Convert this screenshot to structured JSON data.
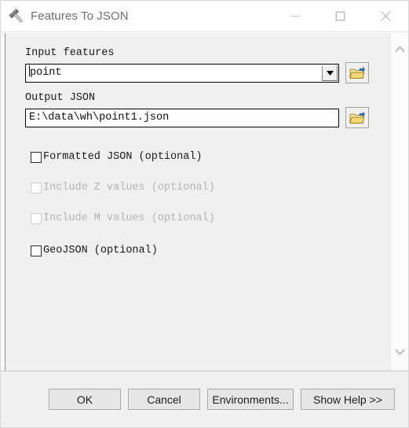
{
  "window": {
    "title": "Features To JSON",
    "icon": "hammer-tool-icon",
    "controls": {
      "minimize": "minimize-icon",
      "maximize": "maximize-icon",
      "close": "close-icon"
    }
  },
  "form": {
    "input_features": {
      "label": "Input features",
      "value": "point",
      "dropdown_icon": "chevron-down-icon",
      "browse_icon": "folder-browse-icon"
    },
    "output_json": {
      "label": "Output JSON",
      "value": "E:\\data\\wh\\point1.json",
      "browse_icon": "folder-browse-icon"
    },
    "checkboxes": [
      {
        "label": "Formatted JSON (optional)",
        "checked": false,
        "enabled": true
      },
      {
        "label": "Include Z values (optional)",
        "checked": false,
        "enabled": false
      },
      {
        "label": "Include M values (optional)",
        "checked": false,
        "enabled": false
      },
      {
        "label": "GeoJSON (optional)",
        "checked": false,
        "enabled": true
      }
    ]
  },
  "scrollbar": {
    "up_icon": "chevron-up-icon",
    "down_icon": "chevron-down-icon"
  },
  "footer": {
    "ok": "OK",
    "cancel": "Cancel",
    "environments": "Environments...",
    "show_help": "Show Help >>"
  },
  "colors": {
    "panel_bg": "#f0f0f0",
    "titlebar_bg": "#ffffff",
    "title_text": "#6f6f6f",
    "field_text": "#0d0d0d",
    "disabled_text": "#b4b4b4",
    "folder_yellow": "#f4d98a",
    "folder_arrow_blue": "#2d7fd8"
  }
}
